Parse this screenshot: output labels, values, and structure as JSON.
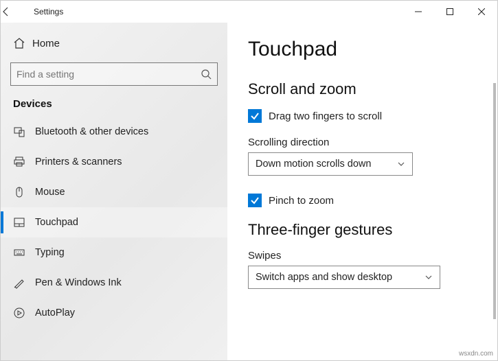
{
  "window": {
    "title": "Settings"
  },
  "sidebar": {
    "home": "Home",
    "searchPlaceholder": "Find a setting",
    "section": "Devices",
    "items": [
      {
        "label": "Bluetooth & other devices"
      },
      {
        "label": "Printers & scanners"
      },
      {
        "label": "Mouse"
      },
      {
        "label": "Touchpad"
      },
      {
        "label": "Typing"
      },
      {
        "label": "Pen & Windows Ink"
      },
      {
        "label": "AutoPlay"
      }
    ]
  },
  "page": {
    "title": "Touchpad",
    "section1": "Scroll and zoom",
    "dragTwoFingers": "Drag two fingers to scroll",
    "scrollDirectionLabel": "Scrolling direction",
    "scrollDirectionValue": "Down motion scrolls down",
    "pinchZoom": "Pinch to zoom",
    "section2": "Three-finger gestures",
    "swipesLabel": "Swipes",
    "swipesValue": "Switch apps and show desktop"
  },
  "watermark": "wsxdn.com"
}
